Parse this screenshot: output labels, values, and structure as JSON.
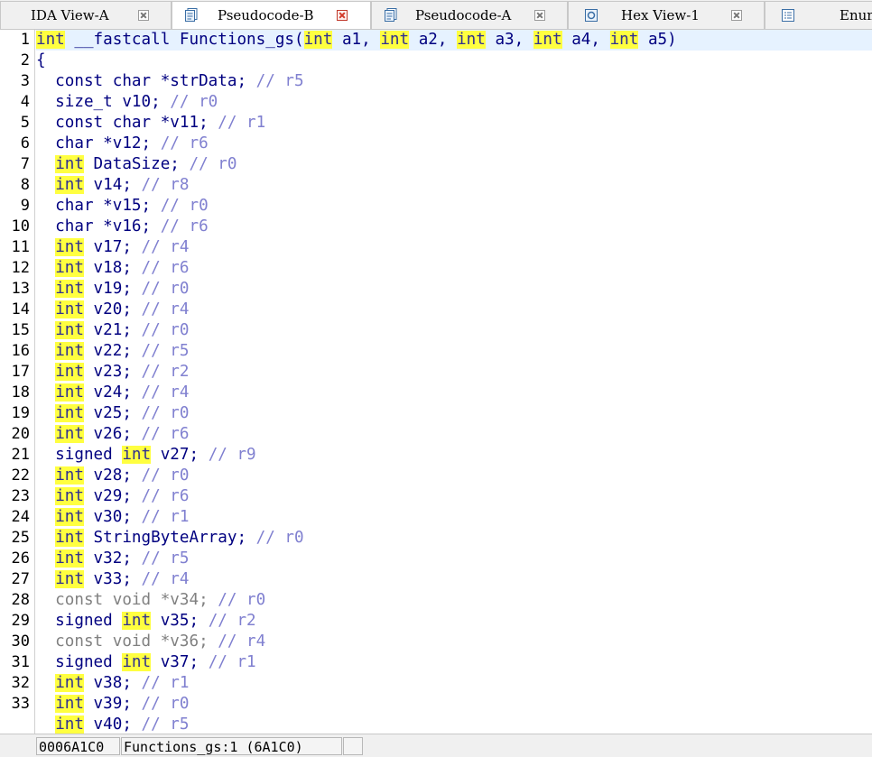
{
  "tabs": [
    {
      "label": "IDA View-A",
      "icon": "disassembly-view-icon",
      "active": false
    },
    {
      "label": "Pseudocode-B",
      "icon": "pseudocode-icon",
      "active": true
    },
    {
      "label": "Pseudocode-A",
      "icon": "pseudocode-icon",
      "active": false
    },
    {
      "label": "Hex View-1",
      "icon": "hex-view-icon",
      "active": false
    },
    {
      "label": "Enum",
      "icon": "enums-icon",
      "active": false
    }
  ],
  "editor": {
    "line_numbers": [
      "1",
      "2",
      "3",
      "4",
      "5",
      "6",
      "7",
      "8",
      "9",
      "10",
      "11",
      "12",
      "13",
      "14",
      "15",
      "16",
      "17",
      "18",
      "19",
      "20",
      "21",
      "22",
      "23",
      "24",
      "25",
      "26",
      "27",
      "28",
      "29",
      "30",
      "31",
      "32",
      "33"
    ],
    "lines": [
      [
        {
          "t": "int",
          "c": "kw"
        },
        {
          "t": " __fastcall Functions_gs("
        },
        {
          "t": "int",
          "c": "kw"
        },
        {
          "t": " a1, "
        },
        {
          "t": "int",
          "c": "kw"
        },
        {
          "t": " a2, "
        },
        {
          "t": "int",
          "c": "kw"
        },
        {
          "t": " a3, "
        },
        {
          "t": "int",
          "c": "kw"
        },
        {
          "t": " a4, "
        },
        {
          "t": "int",
          "c": "kw"
        },
        {
          "t": " a5)"
        }
      ],
      [
        {
          "t": "{"
        }
      ],
      [
        {
          "t": "  const char *strData; "
        },
        {
          "t": "// r5",
          "c": "cm"
        }
      ],
      [
        {
          "t": "  size_t v10; "
        },
        {
          "t": "// r0",
          "c": "cm"
        }
      ],
      [
        {
          "t": "  const char *v11; "
        },
        {
          "t": "// r1",
          "c": "cm"
        }
      ],
      [
        {
          "t": "  char *v12; "
        },
        {
          "t": "// r6",
          "c": "cm"
        }
      ],
      [
        {
          "t": "  "
        },
        {
          "t": "int",
          "c": "kw"
        },
        {
          "t": " DataSize; "
        },
        {
          "t": "// r0",
          "c": "cm"
        }
      ],
      [
        {
          "t": "  "
        },
        {
          "t": "int",
          "c": "kw"
        },
        {
          "t": " v14; "
        },
        {
          "t": "// r8",
          "c": "cm"
        }
      ],
      [
        {
          "t": "  char *v15; "
        },
        {
          "t": "// r0",
          "c": "cm"
        }
      ],
      [
        {
          "t": "  char *v16; "
        },
        {
          "t": "// r6",
          "c": "cm"
        }
      ],
      [
        {
          "t": "  "
        },
        {
          "t": "int",
          "c": "kw"
        },
        {
          "t": " v17; "
        },
        {
          "t": "// r4",
          "c": "cm"
        }
      ],
      [
        {
          "t": "  "
        },
        {
          "t": "int",
          "c": "kw"
        },
        {
          "t": " v18; "
        },
        {
          "t": "// r6",
          "c": "cm"
        }
      ],
      [
        {
          "t": "  "
        },
        {
          "t": "int",
          "c": "kw"
        },
        {
          "t": " v19; "
        },
        {
          "t": "// r0",
          "c": "cm"
        }
      ],
      [
        {
          "t": "  "
        },
        {
          "t": "int",
          "c": "kw"
        },
        {
          "t": " v20; "
        },
        {
          "t": "// r4",
          "c": "cm"
        }
      ],
      [
        {
          "t": "  "
        },
        {
          "t": "int",
          "c": "kw"
        },
        {
          "t": " v21; "
        },
        {
          "t": "// r0",
          "c": "cm"
        }
      ],
      [
        {
          "t": "  "
        },
        {
          "t": "int",
          "c": "kw"
        },
        {
          "t": " v22; "
        },
        {
          "t": "// r5",
          "c": "cm"
        }
      ],
      [
        {
          "t": "  "
        },
        {
          "t": "int",
          "c": "kw"
        },
        {
          "t": " v23; "
        },
        {
          "t": "// r2",
          "c": "cm"
        }
      ],
      [
        {
          "t": "  "
        },
        {
          "t": "int",
          "c": "kw"
        },
        {
          "t": " v24; "
        },
        {
          "t": "// r4",
          "c": "cm"
        }
      ],
      [
        {
          "t": "  "
        },
        {
          "t": "int",
          "c": "kw"
        },
        {
          "t": " v25; "
        },
        {
          "t": "// r0",
          "c": "cm"
        }
      ],
      [
        {
          "t": "  "
        },
        {
          "t": "int",
          "c": "kw"
        },
        {
          "t": " v26; "
        },
        {
          "t": "// r6",
          "c": "cm"
        }
      ],
      [
        {
          "t": "  signed "
        },
        {
          "t": "int",
          "c": "kw"
        },
        {
          "t": " v27; "
        },
        {
          "t": "// r9",
          "c": "cm"
        }
      ],
      [
        {
          "t": "  "
        },
        {
          "t": "int",
          "c": "kw"
        },
        {
          "t": " v28; "
        },
        {
          "t": "// r0",
          "c": "cm"
        }
      ],
      [
        {
          "t": "  "
        },
        {
          "t": "int",
          "c": "kw"
        },
        {
          "t": " v29; "
        },
        {
          "t": "// r6",
          "c": "cm"
        }
      ],
      [
        {
          "t": "  "
        },
        {
          "t": "int",
          "c": "kw"
        },
        {
          "t": " v30; "
        },
        {
          "t": "// r1",
          "c": "cm"
        }
      ],
      [
        {
          "t": "  "
        },
        {
          "t": "int",
          "c": "kw"
        },
        {
          "t": " StringByteArray; "
        },
        {
          "t": "// r0",
          "c": "cm"
        }
      ],
      [
        {
          "t": "  "
        },
        {
          "t": "int",
          "c": "kw"
        },
        {
          "t": " v32; "
        },
        {
          "t": "// r5",
          "c": "cm"
        }
      ],
      [
        {
          "t": "  "
        },
        {
          "t": "int",
          "c": "kw"
        },
        {
          "t": " v33; "
        },
        {
          "t": "// r4",
          "c": "cm"
        }
      ],
      [
        {
          "t": "  const void *v34; ",
          "c": "gr"
        },
        {
          "t": "// r0",
          "c": "cm"
        }
      ],
      [
        {
          "t": "  signed "
        },
        {
          "t": "int",
          "c": "kw"
        },
        {
          "t": " v35; "
        },
        {
          "t": "// r2",
          "c": "cm"
        }
      ],
      [
        {
          "t": "  const void *v36; ",
          "c": "gr"
        },
        {
          "t": "// r4",
          "c": "cm"
        }
      ],
      [
        {
          "t": "  signed "
        },
        {
          "t": "int",
          "c": "kw"
        },
        {
          "t": " v37; "
        },
        {
          "t": "// r1",
          "c": "cm"
        }
      ],
      [
        {
          "t": "  "
        },
        {
          "t": "int",
          "c": "kw"
        },
        {
          "t": " v38; "
        },
        {
          "t": "// r1",
          "c": "cm"
        }
      ],
      [
        {
          "t": "  "
        },
        {
          "t": "int",
          "c": "kw"
        },
        {
          "t": " v39; "
        },
        {
          "t": "// r0",
          "c": "cm"
        }
      ],
      [
        {
          "t": "  "
        },
        {
          "t": "int",
          "c": "kw"
        },
        {
          "t": " v40; "
        },
        {
          "t": "// r5",
          "c": "cm"
        }
      ]
    ]
  },
  "status": {
    "address": "0006A1C0",
    "location": "Functions_gs:1 (6A1C0)"
  },
  "colors": {
    "keyword_highlight": "#ffff40",
    "comment": "#8080d0",
    "code_text": "#000080",
    "current_line": "#e6f2ff"
  }
}
